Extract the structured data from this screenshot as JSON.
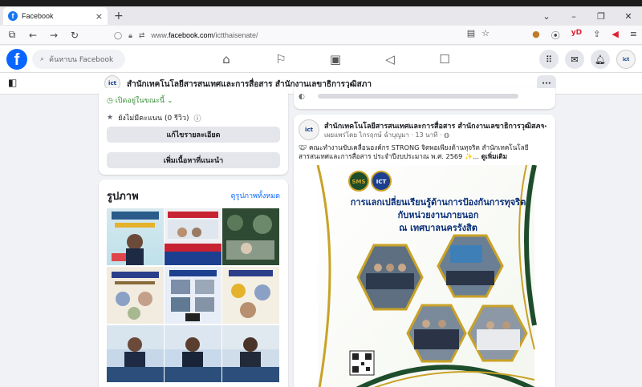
{
  "browser": {
    "tab_title": "Facebook",
    "tab_close": "×",
    "new_tab": "+",
    "url_prefix": "www.",
    "url_domain": "facebook.com",
    "url_path": "/ictthaisenate/"
  },
  "fb": {
    "logo": "f",
    "search_placeholder": "ค้นหาบน Facebook"
  },
  "page": {
    "name": "สำนักเทคโนโลยีสารสนเทศและการสื่อสาร สำนักงานเลขาธิการวุฒิสภา",
    "logo_text": "ict"
  },
  "about": {
    "status": "เปิดอยู่ในขณะนี้",
    "reviews": "ยังไม่มีคะแนน (0 รีวิว)",
    "edit_details": "แก้ไขรายละเอียด",
    "add_featured": "เพิ่มเนื้อหาที่แนะนำ"
  },
  "photos": {
    "title": "รูปภาพ",
    "see_all": "ดูรูปภาพทั้งหมด"
  },
  "post": {
    "author": "สำนักเทคโนโลยีสารสนเทศและการสื่อสาร สำนักงานเลขาธิการวุฒิสภา",
    "meta": "เผยแพร่โดย ไกรฤกษ์ ฉ่ำบุญมา · 13 นาที ·",
    "text": "คณะทำงานขับเคลื่อนองค์กร STRONG จิตพอเพียงต้านทุจริต สำนักเทคโนโลยีสารสนเทศและการสื่อสาร ประจำปีงบประมาณ พ.ศ. 2569 ✨...",
    "see_more": "ดูเพิ่มเติม",
    "image_title_1": "การแลกเปลี่ยนเรียนรู้ด้านการป้องกันการทุจริต",
    "image_title_2": "กับหน่วยงานภายนอก",
    "image_title_3": "ณ เทศบาลนครรังสิต",
    "logo_sms": "SMS",
    "logo_ict": "ICT"
  },
  "colors": {
    "fb_blue": "#0866ff",
    "page_bg": "#f0f2f5",
    "gold": "#c9a227",
    "dark_green": "#1e4d2b"
  }
}
